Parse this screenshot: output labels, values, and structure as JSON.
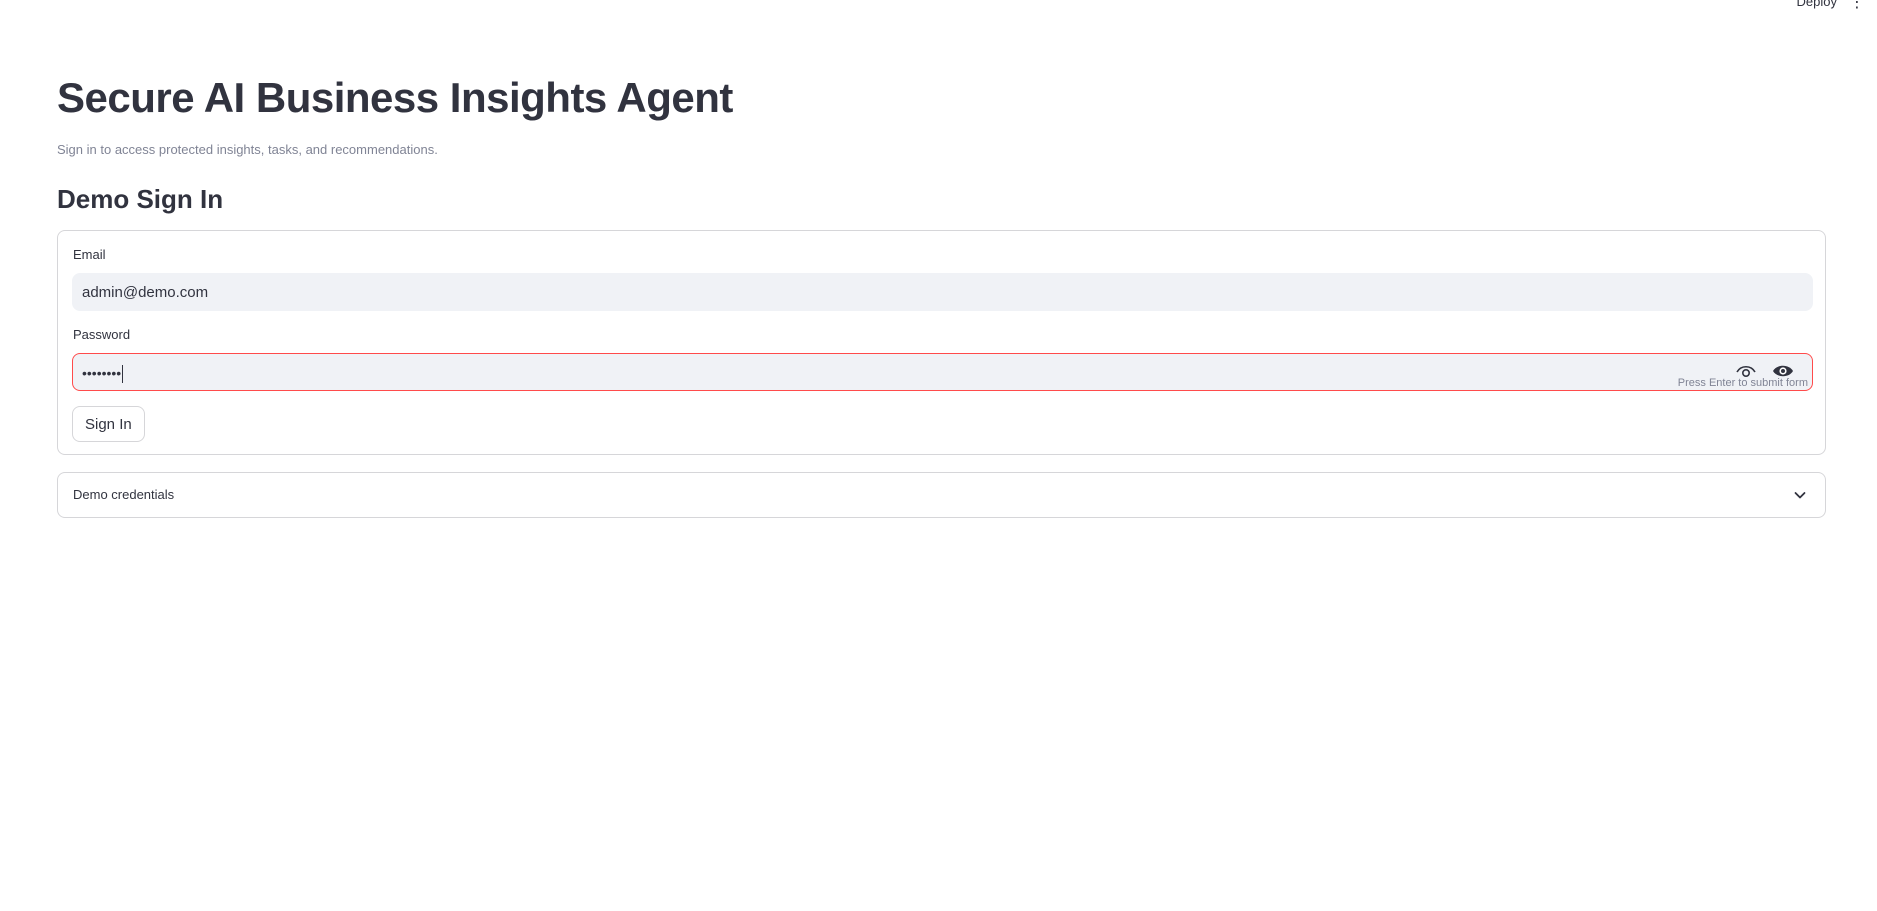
{
  "toolbar": {
    "deploy_label": "Deploy",
    "menu_icon": "kebab-menu-icon"
  },
  "header": {
    "title": "Secure AI Business Insights Agent",
    "subtitle": "Sign in to access protected insights, tasks, and recommendations."
  },
  "section": {
    "title": "Demo Sign In"
  },
  "form": {
    "email": {
      "label": "Email",
      "value": "admin@demo.com"
    },
    "password": {
      "label": "Password",
      "masked_value": "••••••••",
      "hint": "Press Enter to submit form",
      "icons": [
        "eye-open-icon",
        "show-password-icon"
      ]
    },
    "submit_label": "Sign In"
  },
  "expander": {
    "label": "Demo credentials",
    "icon": "chevron-down-icon",
    "expanded": false
  },
  "colors": {
    "text": "#31333f",
    "muted": "#808495",
    "input_bg": "#f0f2f6",
    "border": "#d6d6d9",
    "focus_border": "#ff4b4b"
  }
}
